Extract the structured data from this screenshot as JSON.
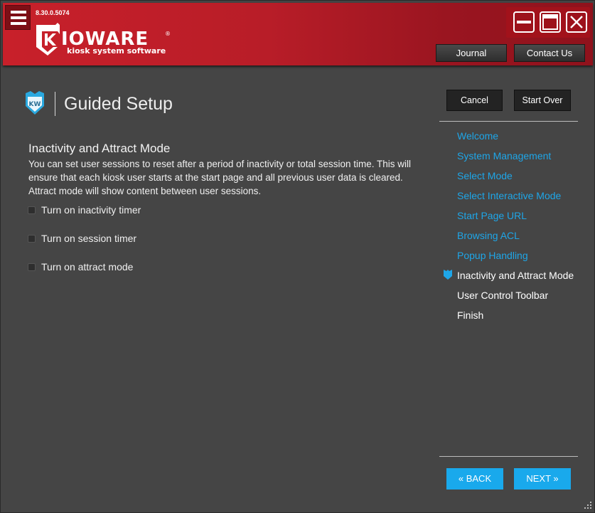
{
  "app": {
    "version": "8.30.0.5074",
    "logo_text": "KIOWARE",
    "logo_tagline": "kiosk system software"
  },
  "header": {
    "journal_label": "Journal",
    "contact_label": "Contact Us"
  },
  "page": {
    "title": "Guided Setup",
    "cancel_label": "Cancel",
    "start_over_label": "Start Over"
  },
  "section": {
    "title": "Inactivity and Attract Mode",
    "description": "You can set user sessions to reset after a period of inactivity or total session time. This will ensure that each kiosk user starts at the start page and all previous user data is cleared. Attract mode will show content between user sessions.",
    "options": [
      {
        "label": "Turn on inactivity timer",
        "checked": false
      },
      {
        "label": "Turn on session timer",
        "checked": false
      },
      {
        "label": "Turn on attract mode",
        "checked": false
      }
    ]
  },
  "steps": [
    {
      "label": "Welcome",
      "state": "done"
    },
    {
      "label": "System Management",
      "state": "done"
    },
    {
      "label": "Select Mode",
      "state": "done"
    },
    {
      "label": "Select Interactive Mode",
      "state": "done"
    },
    {
      "label": "Start Page URL",
      "state": "done"
    },
    {
      "label": "Browsing ACL",
      "state": "done"
    },
    {
      "label": "Popup Handling",
      "state": "done"
    },
    {
      "label": "Inactivity and Attract Mode",
      "state": "current"
    },
    {
      "label": "User Control Toolbar",
      "state": "todo"
    },
    {
      "label": "Finish",
      "state": "todo"
    }
  ],
  "footer": {
    "back_label": "BACK",
    "next_label": "NEXT"
  },
  "colors": {
    "accent": "#1ea6e8",
    "header_red": "#c8202a",
    "panel": "#454545"
  }
}
